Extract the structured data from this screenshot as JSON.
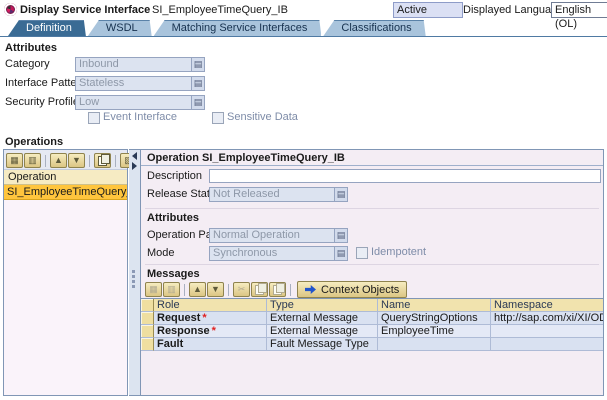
{
  "colors": {
    "active_tab": "#3a6b94",
    "selected_row": "#ffc53d",
    "table_header_bg": "#f1e3ae",
    "required_marker_color": "#e02020",
    "panel_border": "#8096b5"
  },
  "header": {
    "icon": "service-interface-icon",
    "title": "Display Service Interface",
    "object_name": "SI_EmployeeTimeQuery_IB",
    "status_value": "Active",
    "language_label": "Displayed Language",
    "language_value": "English (OL)"
  },
  "tabs": [
    {
      "label": "Definition",
      "active": true
    },
    {
      "label": "WSDL",
      "active": false
    },
    {
      "label": "Matching Service Interfaces",
      "active": false
    },
    {
      "label": "Classifications",
      "active": false
    }
  ],
  "attributes": {
    "section_title": "Attributes",
    "category_label": "Category",
    "category_value": "Inbound",
    "interface_pattern_label": "Interface Pattern",
    "interface_pattern_value": "Stateless",
    "security_profile_label": "Security Profile",
    "security_profile_value": "Low",
    "event_interface_label": "Event Interface",
    "sensitive_data_label": "Sensitive Data"
  },
  "operations": {
    "section_title": "Operations",
    "toolbar_icons": [
      "insert-operation",
      "delete-operation",
      "move-up",
      "move-down",
      "copy-operation",
      "referenced-operation"
    ],
    "column_header": "Operation",
    "rows": [
      {
        "name": "SI_EmployeeTimeQuery_IB",
        "selected": true
      }
    ]
  },
  "operation_detail": {
    "title": "Operation SI_EmployeeTimeQuery_IB",
    "description_label": "Description",
    "description_value": "",
    "release_state_label": "Release State",
    "release_state_value": "Not Released",
    "attributes_title": "Attributes",
    "operation_pattern_label": "Operation Pattern",
    "operation_pattern_value": "Normal Operation",
    "mode_label": "Mode",
    "mode_value": "Synchronous",
    "idempotent_label": "Idempotent"
  },
  "messages": {
    "section_title": "Messages",
    "toolbar_icons": [
      "insert-row",
      "delete-row",
      "move-up",
      "move-down",
      "cut",
      "copy",
      "paste"
    ],
    "context_objects_label": "Context Objects",
    "required_marker": "*",
    "columns": [
      "Role",
      "Type",
      "Name",
      "Namespace"
    ],
    "rows": [
      {
        "role": "Request",
        "required": true,
        "type": "External Message",
        "name": "QueryStringOptions",
        "namespace": "http://sap.com/xi/XI/OData"
      },
      {
        "role": "Response",
        "required": true,
        "type": "External Message",
        "name": "EmployeeTime",
        "namespace": ""
      },
      {
        "role": "Fault",
        "required": false,
        "type": "Fault Message Type",
        "name": "",
        "namespace": ""
      }
    ]
  }
}
